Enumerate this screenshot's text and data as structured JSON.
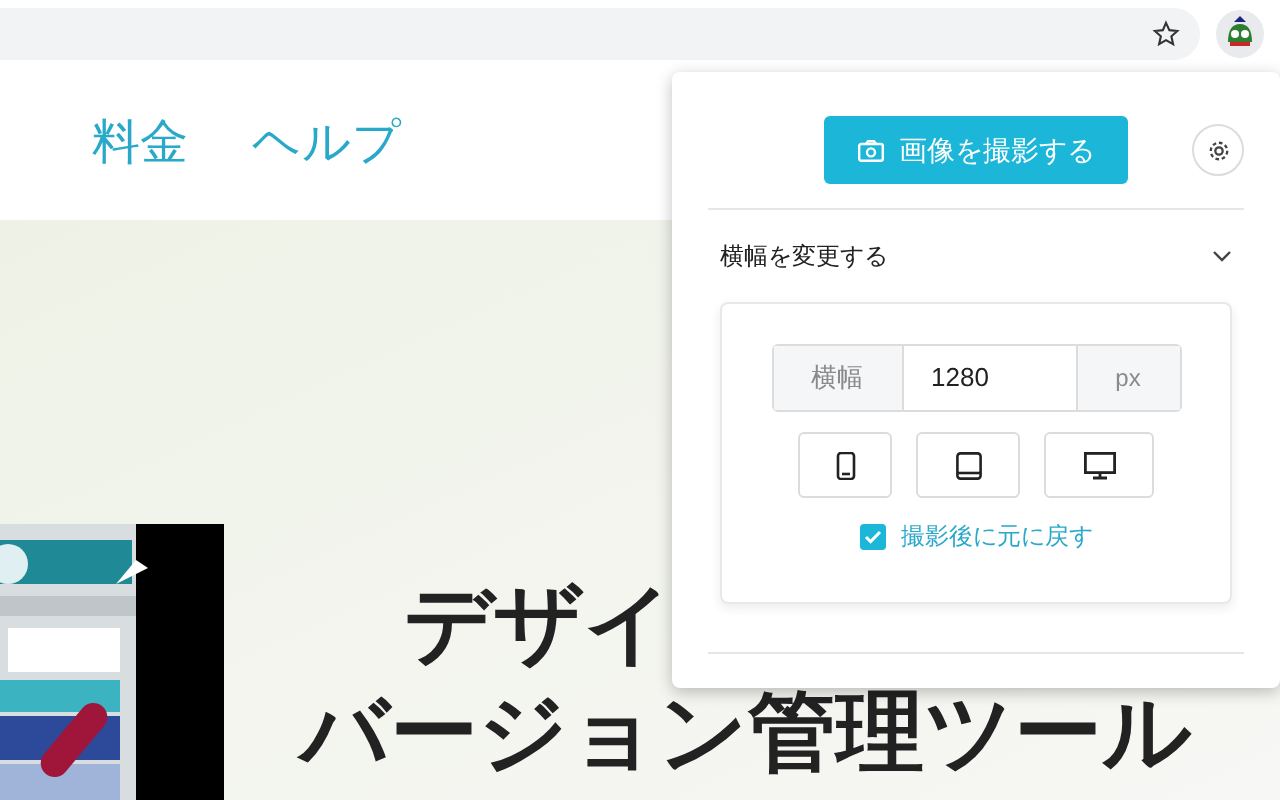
{
  "browser": {
    "bookmarked": false
  },
  "nav": [
    "料金",
    "ヘルプ"
  ],
  "hero": {
    "headline_lines": [
      "デザイ",
      "バージョン管理ツール"
    ],
    "phone": {
      "kind": "picture"
    }
  },
  "popup": {
    "capture_button": "画像を撮影する",
    "section": {
      "title": "横幅を変更する",
      "expanded": true
    },
    "width_field": {
      "label": "横幅",
      "value": "1280",
      "unit": "px"
    },
    "devices": [
      {
        "kind": "phone",
        "selected": false
      },
      {
        "kind": "tablet",
        "selected": false
      },
      {
        "kind": "desktop",
        "selected": false
      }
    ],
    "restore": {
      "label": "撮影後に元に戻す",
      "checked": true
    }
  }
}
